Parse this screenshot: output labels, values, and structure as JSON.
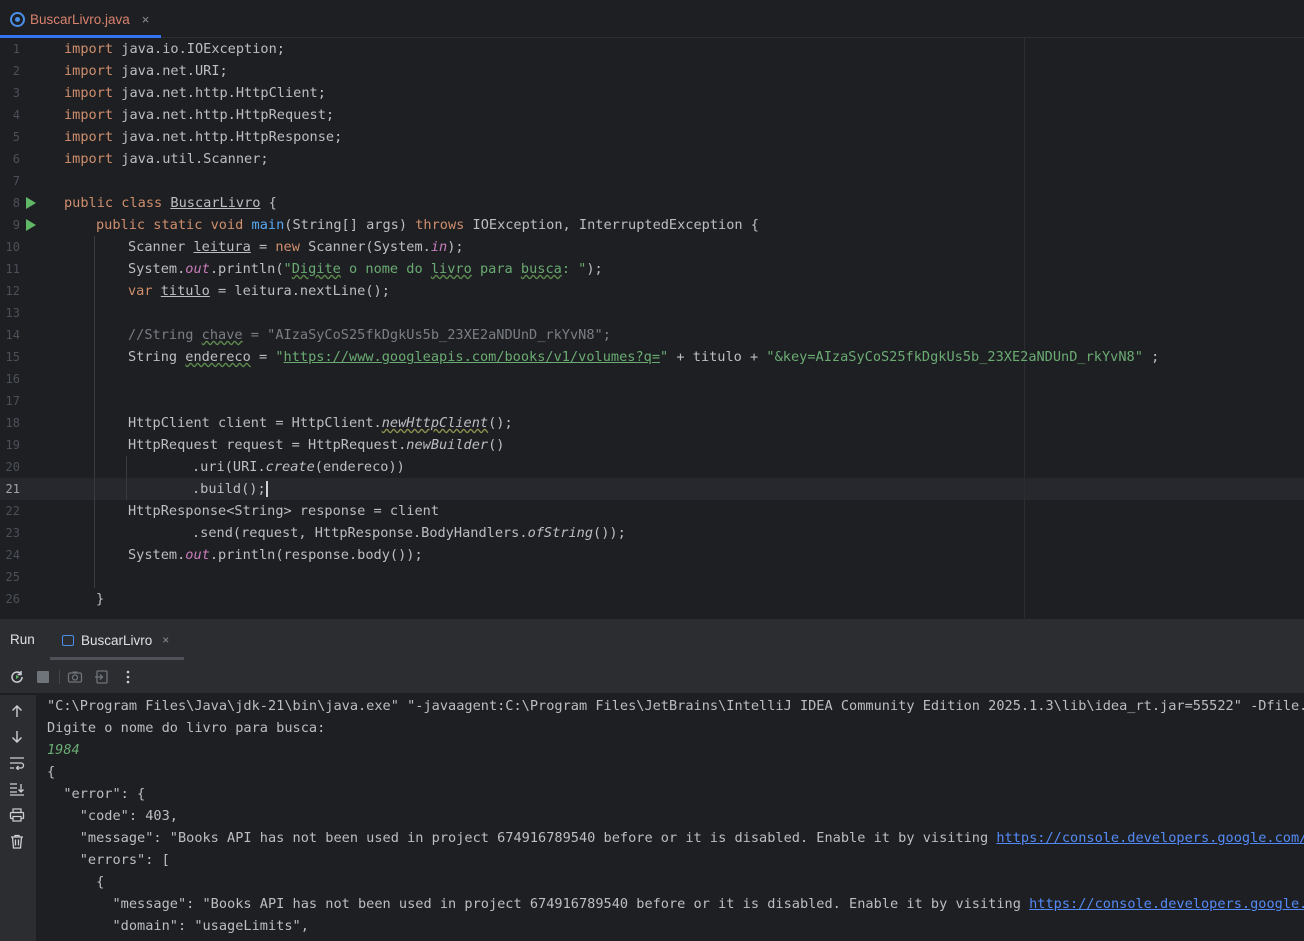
{
  "tab": {
    "filename": "BuscarLivro.java",
    "close": "×",
    "icon": "java-class-icon"
  },
  "editor": {
    "line_numbers": [
      "1",
      "2",
      "3",
      "4",
      "5",
      "6",
      "7",
      "8",
      "9",
      "10",
      "11",
      "12",
      "13",
      "14",
      "15",
      "16",
      "17",
      "18",
      "19",
      "20",
      "21",
      "22",
      "23",
      "24",
      "25",
      "26"
    ],
    "current_line": "21",
    "run_gutter_lines": [
      "8",
      "9"
    ]
  },
  "code": {
    "l1": [
      "import",
      " java.io.IOException;"
    ],
    "l2": [
      "import",
      " java.net.URI;"
    ],
    "l3": [
      "import",
      " java.net.http.HttpClient;"
    ],
    "l4": [
      "import",
      " java.net.http.HttpRequest;"
    ],
    "l5": [
      "import",
      " java.net.http.HttpResponse;"
    ],
    "l6": [
      "import",
      " java.util.Scanner;"
    ],
    "l8": [
      "public class",
      " ",
      "BuscarLivro",
      " {"
    ],
    "l9": [
      "public static void",
      " ",
      "main",
      "(String[] args) ",
      "throws",
      " IOException, InterruptedException {"
    ],
    "l10": [
      "Scanner ",
      "leitura",
      " = ",
      "new",
      " Scanner(System.",
      "in",
      ");"
    ],
    "l11": [
      "System.",
      "out",
      ".println(",
      "\"",
      "Digite",
      " o nome do ",
      "livro",
      " para ",
      "busca",
      ": \"",
      ");"
    ],
    "l12": [
      "var",
      " ",
      "titulo",
      " = leitura.nextLine();"
    ],
    "l14": [
      "//String ",
      "chave",
      " = \"AIzaSyCoS25fkDgkUs5b_23XE2aNDUnD_rkYvN8\";"
    ],
    "l15": [
      "String ",
      "endereco",
      " = ",
      "\"",
      "https://www.googleapis.com/books/v1/volumes?q=",
      "\"",
      " + titulo + ",
      "\"&key=AIzaSyCoS25fkDgkUs5b_23XE2aNDUnD_rkYvN8\"",
      " ;"
    ],
    "l18": [
      "HttpClient client = HttpClient.",
      "newHttpClient",
      "();"
    ],
    "l19": [
      "HttpRequest request = HttpRequest.",
      "newBuilder",
      "()"
    ],
    "l20": [
      ".uri(URI.",
      "create",
      "(endereco))"
    ],
    "l21": [
      ".build();"
    ],
    "l22": [
      "HttpResponse<String> response = client"
    ],
    "l23": [
      ".send(request, HttpResponse.BodyHandlers.",
      "ofString",
      "());"
    ],
    "l24": [
      "System.",
      "out",
      ".println(response.body());"
    ],
    "l26": [
      "}"
    ]
  },
  "run_panel": {
    "title": "Run",
    "tab_label": "BuscarLivro",
    "tab_close": "×"
  },
  "console": {
    "cmd": "\"C:\\Program Files\\Java\\jdk-21\\bin\\java.exe\" \"-javaagent:C:\\Program Files\\JetBrains\\IntelliJ IDEA Community Edition 2025.1.3\\lib\\idea_rt.jar=55522\" -Dfile.enc",
    "prompt": "Digite o nome do livro para busca:",
    "input": "1984",
    "j1": "{",
    "j2": "  \"error\": {",
    "j3": "    \"code\": 403,",
    "j4": "    \"message\": \"Books API has not been used in project 674916789540 before or it is disabled. Enable it by visiting ",
    "j4_link": "https://console.developers.google.com/api",
    "j5": "    \"errors\": [",
    "j6": "      {",
    "j7": "        \"message\": \"Books API has not been used in project 674916789540 before or it is disabled. Enable it by visiting ",
    "j7_link": "https://console.developers.google.com",
    "j8": "        \"domain\": \"usageLimits\","
  }
}
